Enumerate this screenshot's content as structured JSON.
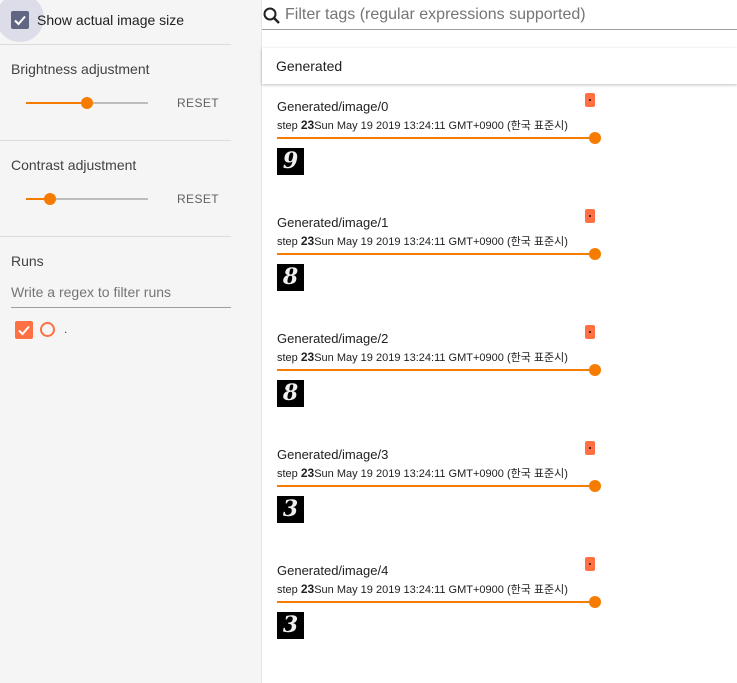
{
  "sidebar": {
    "show_actual_size_label": "Show actual image size",
    "brightness": {
      "title": "Brightness adjustment",
      "reset_label": "RESET",
      "level": 0.5
    },
    "contrast": {
      "title": "Contrast adjustment",
      "reset_label": "RESET",
      "level": 0.2
    },
    "runs": {
      "title": "Runs",
      "filter_placeholder": "Write a regex to filter runs",
      "items": [
        {
          "name": "."
        }
      ]
    }
  },
  "main": {
    "filter_placeholder": "Filter tags (regular expressions supported)",
    "group": {
      "title": "Generated"
    },
    "cards": [
      {
        "title": "Generated/image/0",
        "step_label": "step",
        "step": "23",
        "timestamp": "Sun May 19 2019 13:24:11 GMT+0900 (한국 표준시)",
        "digit": "9"
      },
      {
        "title": "Generated/image/1",
        "step_label": "step",
        "step": "23",
        "timestamp": "Sun May 19 2019 13:24:11 GMT+0900 (한국 표준시)",
        "digit": "8"
      },
      {
        "title": "Generated/image/2",
        "step_label": "step",
        "step": "23",
        "timestamp": "Sun May 19 2019 13:24:11 GMT+0900 (한국 표준시)",
        "digit": "8"
      },
      {
        "title": "Generated/image/3",
        "step_label": "step",
        "step": "23",
        "timestamp": "Sun May 19 2019 13:24:11 GMT+0900 (한국 표준시)",
        "digit": "3"
      },
      {
        "title": "Generated/image/4",
        "step_label": "step",
        "step": "23",
        "timestamp": "Sun May 19 2019 13:24:11 GMT+0900 (한국 표준시)",
        "digit": "3"
      }
    ]
  },
  "colors": {
    "accent": "#f57c00",
    "run": "#ff7043",
    "checkbox": "#616782"
  },
  "icons": {
    "search": "search-icon",
    "check": "check-icon"
  }
}
